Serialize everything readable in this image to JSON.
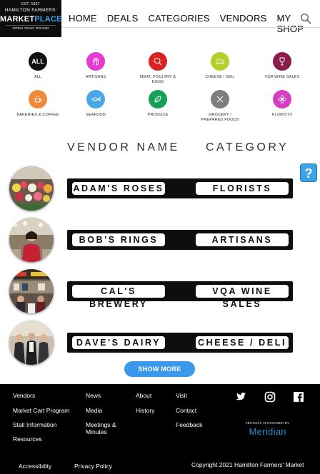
{
  "logo": {
    "est": "EST. 1837",
    "line1": "HAMILTON FARMERS'",
    "market": "MARKET",
    "place": "PLACE",
    "tagline": "OPEN YEAR ROUND"
  },
  "nav": {
    "items": [
      "HOME",
      "DEALS",
      "CATEGORIES",
      "VENDORS",
      "MY SHOP"
    ],
    "search_icon": "search-icon"
  },
  "categories": [
    {
      "label": "ALL",
      "color": "#111111",
      "icon": "all-text"
    },
    {
      "label": "ARTISANS",
      "color": "#e63ad1",
      "icon": "hand-icon"
    },
    {
      "label": "MEAT, POULTRY & EGGS",
      "color": "#d92121",
      "icon": "meat-icon"
    },
    {
      "label": "CHEESE / DELI",
      "color": "#b4cf2a",
      "icon": "cheese-icon"
    },
    {
      "label": "VQA WINE SALES",
      "color": "#8b1d4a",
      "icon": "wine-icon"
    },
    {
      "label": "BAKERIES & COFFEE",
      "color": "#f08a3a",
      "icon": "coffee-icon"
    },
    {
      "label": "SEAFOOD",
      "color": "#4aa7e6",
      "icon": "fish-icon"
    },
    {
      "label": "PRODUCE",
      "color": "#16a058",
      "icon": "leaf-icon"
    },
    {
      "label": "GROCERY / PREPARED FOODS",
      "color": "#7d7d7d",
      "icon": "utensils-icon"
    },
    {
      "label": "FLORISTS",
      "color": "#d63ec2",
      "icon": "flower-icon"
    }
  ],
  "headings": {
    "vendor": "VENDOR NAME",
    "category": "CATEGORY"
  },
  "help": "?",
  "vendors": [
    {
      "name": "ADAM'S ROSES",
      "category": "FLORISTS",
      "photo": "flowers-photo"
    },
    {
      "name": "BOB'S RINGS",
      "category": "ARTISANS",
      "photo": "jewelry-photo"
    },
    {
      "name": "CAL'S BREWERY",
      "category": "VQA WINE SALES",
      "photo": "brewery-photo"
    },
    {
      "name": "DAVE'S DAIRY",
      "category": "CHEESE / DELI",
      "photo": "dairy-photo"
    }
  ],
  "show_more": "SHOW MORE",
  "footer": {
    "col1": [
      "Vendors",
      "Market Cart Program",
      "Stall Information",
      "Resources"
    ],
    "col2": [
      "News",
      "Media",
      "Meetings &",
      "Minutes"
    ],
    "col3": [
      "About",
      "History"
    ],
    "col4": [
      "Visit",
      "Contact",
      "Feedback"
    ],
    "bottom": [
      "Accessibility",
      "Privacy Policy"
    ],
    "sponsor_line": "PROUDLY SPONSORED BY",
    "sponsor_name": "Meridian",
    "copyright": "Copyright 2021 Hamilton Farmers' Market",
    "social": [
      "twitter-icon",
      "instagram-icon",
      "facebook-icon"
    ]
  },
  "colors": {
    "accent": "#3b99ec",
    "bar": "#0e0e0e",
    "footer_bg": "#000000"
  }
}
